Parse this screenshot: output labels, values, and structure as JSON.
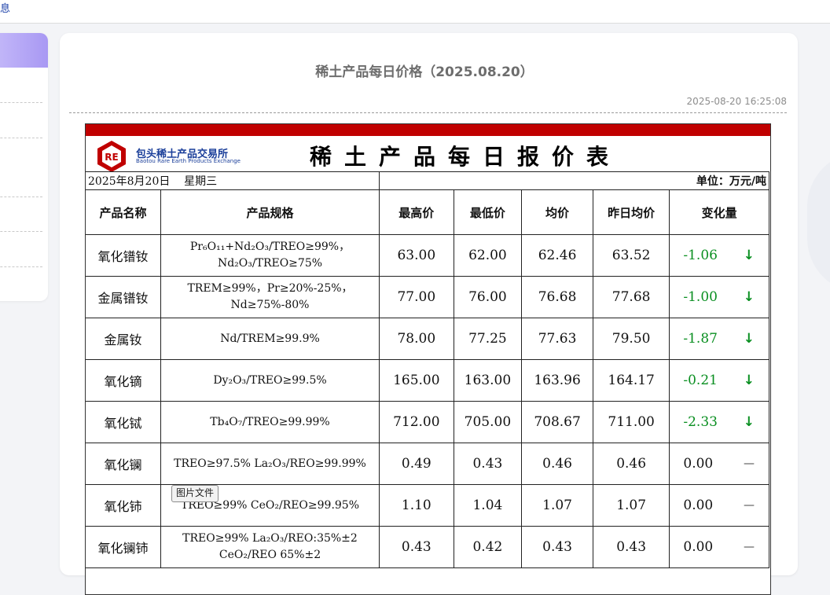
{
  "topbar": {
    "text": "息"
  },
  "page": {
    "title": "稀土产品每日价格（2025.08.20）",
    "timestamp": "2025-08-20 16:25:08"
  },
  "sheet": {
    "logo_cn": "包头稀土产品交易所",
    "logo_en": "Baotou Rare Earth Products Exchange",
    "logo_mark": "RE",
    "title": "稀土产品每日报价表",
    "date": "2025年8月20日",
    "weekday": "星期三",
    "unit": "单位：万元/吨",
    "headers": [
      "产品名称",
      "产品规格",
      "最高价",
      "最低价",
      "均价",
      "昨日均价",
      "变化量"
    ],
    "rows": [
      {
        "name": "氧化镨钕",
        "spec1": "Pr₆O₁₁+Nd₂O₃/TREO≥99%，",
        "spec2": "Nd₂O₃/TREO≥75%",
        "high": "63.00",
        "low": "62.00",
        "avg": "62.46",
        "prev": "63.52",
        "change": "-1.06",
        "trend": "down"
      },
      {
        "name": "金属镨钕",
        "spec1": "TREM≥99%，Pr≥20%-25%，",
        "spec2": "Nd≥75%-80%",
        "high": "77.00",
        "low": "76.00",
        "avg": "76.68",
        "prev": "77.68",
        "change": "-1.00",
        "trend": "down"
      },
      {
        "name": "金属钕",
        "spec1": "Nd/TREM≥99.9%",
        "spec2": "",
        "high": "78.00",
        "low": "77.25",
        "avg": "77.63",
        "prev": "79.50",
        "change": "-1.87",
        "trend": "down"
      },
      {
        "name": "氧化镝",
        "spec1": "Dy₂O₃/TREO≥99.5%",
        "spec2": "",
        "high": "165.00",
        "low": "163.00",
        "avg": "163.96",
        "prev": "164.17",
        "change": "-0.21",
        "trend": "down"
      },
      {
        "name": "氧化铽",
        "spec1": "Tb₄O₇/TREO≥99.99%",
        "spec2": "",
        "high": "712.00",
        "low": "705.00",
        "avg": "708.67",
        "prev": "711.00",
        "change": "-2.33",
        "trend": "down"
      },
      {
        "name": "氧化镧",
        "spec1": "TREO≥97.5%  La₂O₃/REO≥99.99%",
        "spec2": "",
        "high": "0.49",
        "low": "0.43",
        "avg": "0.46",
        "prev": "0.46",
        "change": "0.00",
        "trend": "flat"
      },
      {
        "name": "氧化铈",
        "spec1": "TREO≥99%    CeO₂/REO≥99.95%",
        "spec2": "",
        "high": "1.10",
        "low": "1.04",
        "avg": "1.07",
        "prev": "1.07",
        "change": "0.00",
        "trend": "flat"
      },
      {
        "name": "氧化镧铈",
        "spec1": "TREO≥99%    La₂O₃/REO:35%±2",
        "spec2": "CeO₂/REO 65%±2",
        "high": "0.43",
        "low": "0.42",
        "avg": "0.43",
        "prev": "0.43",
        "change": "0.00",
        "trend": "flat"
      }
    ],
    "trend_symbols": {
      "down": "↓",
      "flat": "—"
    }
  },
  "tooltip": {
    "text": "图片文件"
  },
  "colors": {
    "change_down": "#0a8f21",
    "header_bar": "#c00000",
    "sidebar_active": "#a898f3",
    "logo_blue": "#1b3f9a"
  }
}
